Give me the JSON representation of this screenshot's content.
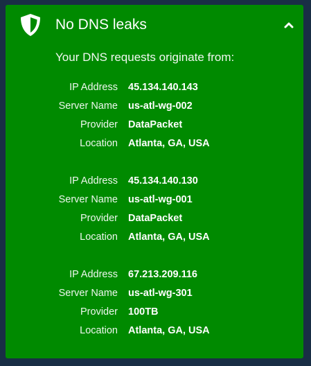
{
  "panel": {
    "title": "No DNS leaks",
    "subtitle": "Your DNS requests originate from:",
    "status_color": "#008a00",
    "icons": {
      "status": "shield-icon",
      "collapse": "chevron-up-icon"
    },
    "labels": {
      "ip": "IP Address",
      "server": "Server Name",
      "provider": "Provider",
      "location": "Location"
    },
    "servers": [
      {
        "ip": "45.134.140.143",
        "server": "us-atl-wg-002",
        "provider": "DataPacket",
        "location": "Atlanta, GA, USA"
      },
      {
        "ip": "45.134.140.130",
        "server": "us-atl-wg-001",
        "provider": "DataPacket",
        "location": "Atlanta, GA, USA"
      },
      {
        "ip": "67.213.209.116",
        "server": "us-atl-wg-301",
        "provider": "100TB",
        "location": "Atlanta, GA, USA"
      }
    ]
  }
}
